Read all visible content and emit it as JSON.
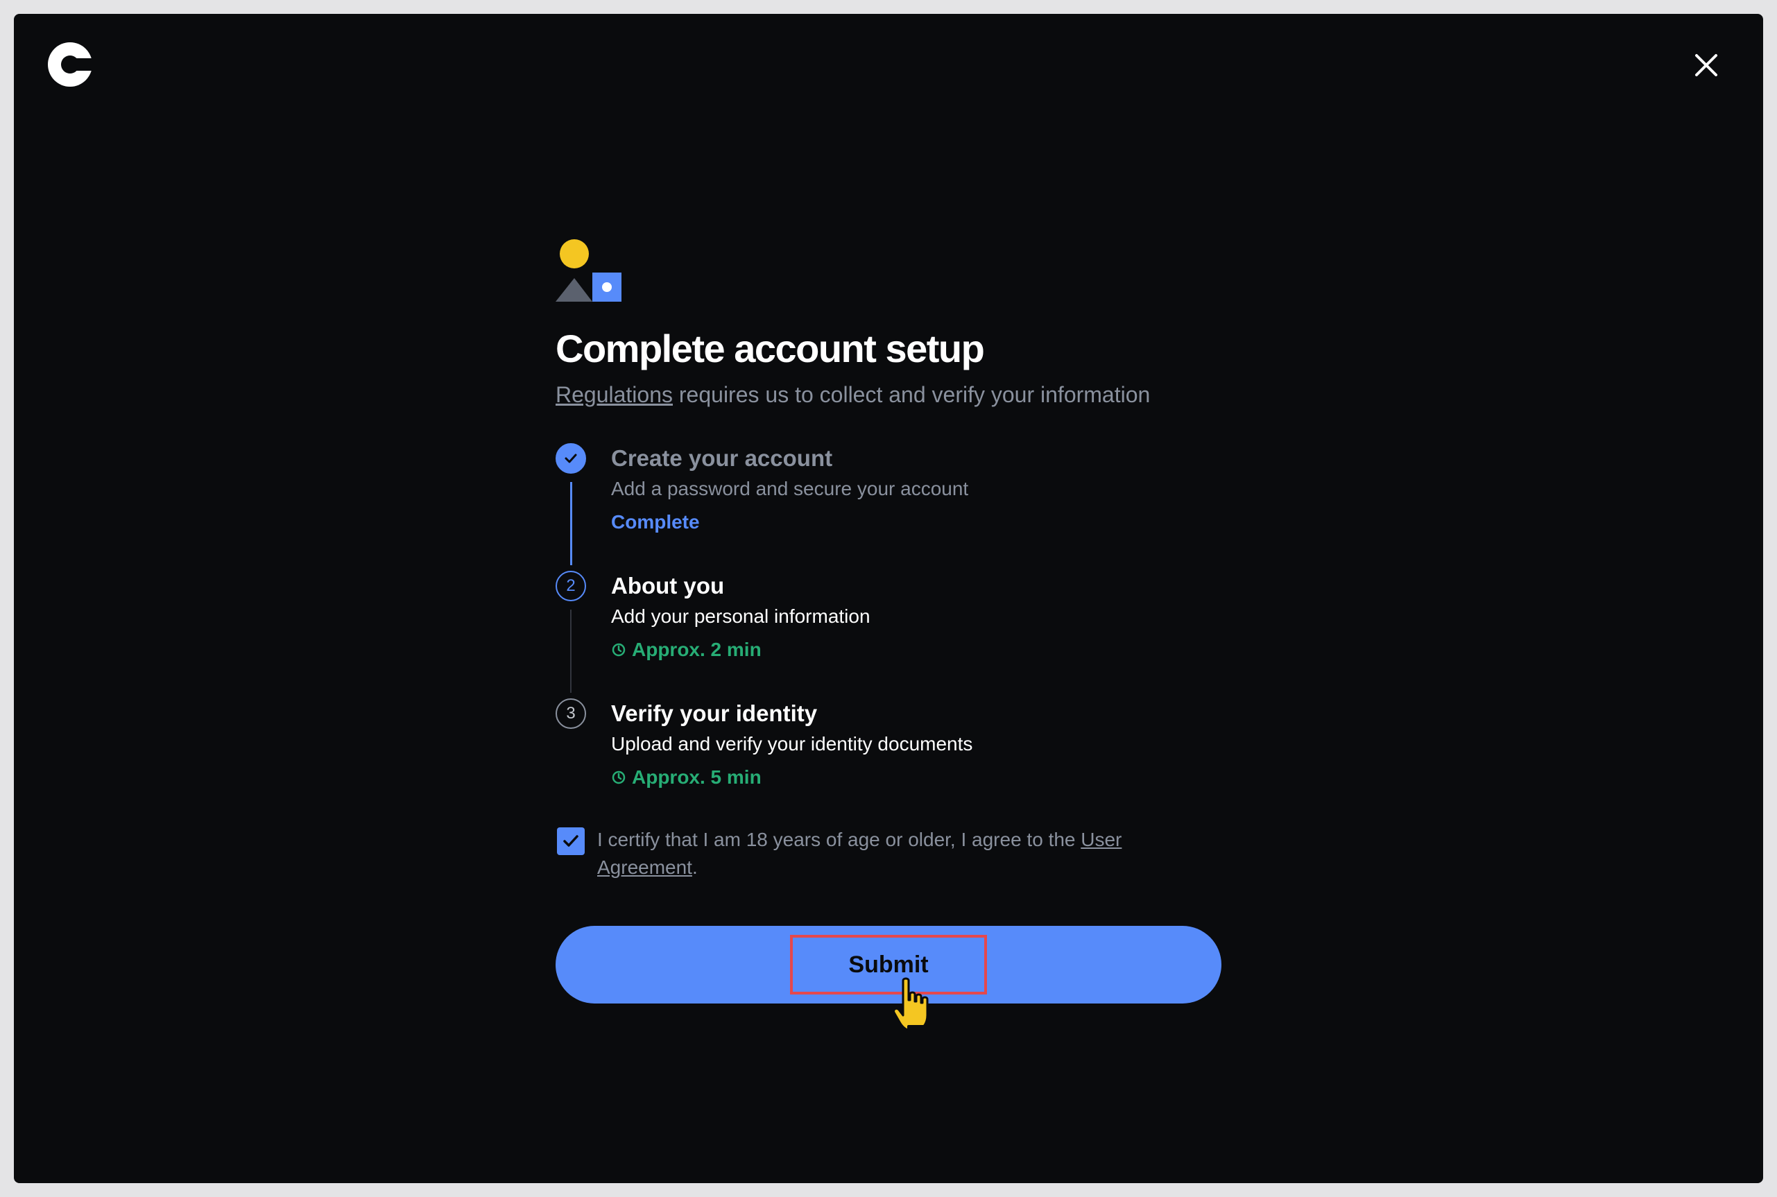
{
  "header": {
    "logo_icon": "coinbase-logo",
    "close_icon": "close-icon"
  },
  "main": {
    "title": "Complete account setup",
    "subtitle_link": "Regulations",
    "subtitle_rest": " requires us to collect and verify your information",
    "steps": [
      {
        "number": "1",
        "title": "Create your account",
        "description": "Add a password and secure your account",
        "status": "Complete",
        "state": "done"
      },
      {
        "number": "2",
        "title": "About you",
        "description": "Add your personal information",
        "status": "Approx. 2 min",
        "state": "active"
      },
      {
        "number": "3",
        "title": "Verify your identity",
        "description": "Upload and verify your identity documents",
        "status": "Approx. 5 min",
        "state": "pending"
      }
    ],
    "agreement": {
      "checked": true,
      "text_before": "I certify that I am 18 years of age or older, I agree to the ",
      "link": "User Agreement",
      "text_after": "."
    },
    "submit_label": "Submit"
  },
  "colors": {
    "background": "#0a0b0d",
    "accent": "#578bfa",
    "success": "#27ad75",
    "muted": "#8a919e",
    "highlight": "#e5484d"
  }
}
